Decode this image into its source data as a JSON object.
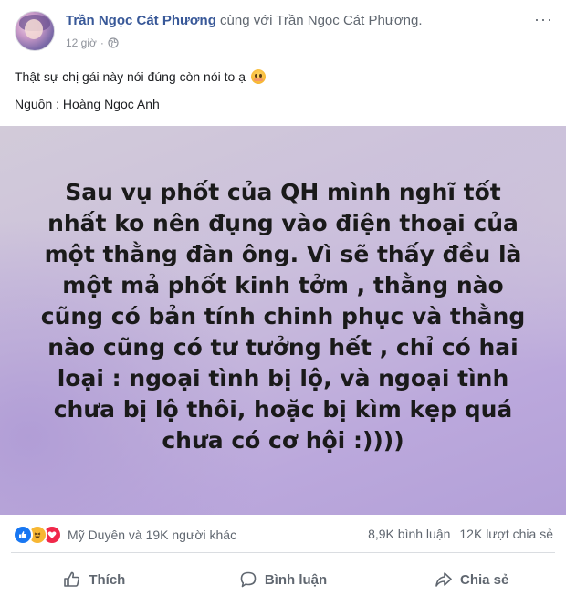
{
  "post": {
    "author": "Trần Ngọc Cát Phương",
    "with_text": "cùng với Trần Ngọc Cát Phương.",
    "time": "12 giờ",
    "more": "···",
    "caption_line1": "Thật sự chị gái này nói đúng còn nói to ạ",
    "caption_line2": "Nguồn : Hoàng Ngọc Anh"
  },
  "image": {
    "lines": [
      "Sau vụ phốt của QH mình nghĩ tốt",
      "nhất ko nên đụng vào điện thoại của",
      "một thằng đàn ông. Vì sẽ thấy đều là",
      "một mả phốt kinh tởm , thằng nào",
      "cũng có bản tính chinh phục và thằng",
      "nào cũng có tư tưởng hết , chỉ có hai",
      "loại : ngoại tình bị lộ, và ngoại tình",
      "chưa bị lộ thôi, hoặc bị kìm kẹp quá",
      "chưa có cơ hội :))))"
    ],
    "background": "#c3b4dc"
  },
  "reactions": {
    "icons": [
      "like-icon",
      "haha-icon",
      "love-icon"
    ],
    "summary": "Mỹ Duyên và 19K người khác",
    "comments": "8,9K bình luận",
    "shares": "12K lượt chia sẻ"
  },
  "actions": {
    "like": "Thích",
    "comment": "Bình luận",
    "share": "Chia sẻ"
  },
  "colors": {
    "name": "#385898",
    "secondary": "#606770",
    "like": "#1877f2",
    "love": "#f0284a",
    "haha": "#f7b733"
  }
}
